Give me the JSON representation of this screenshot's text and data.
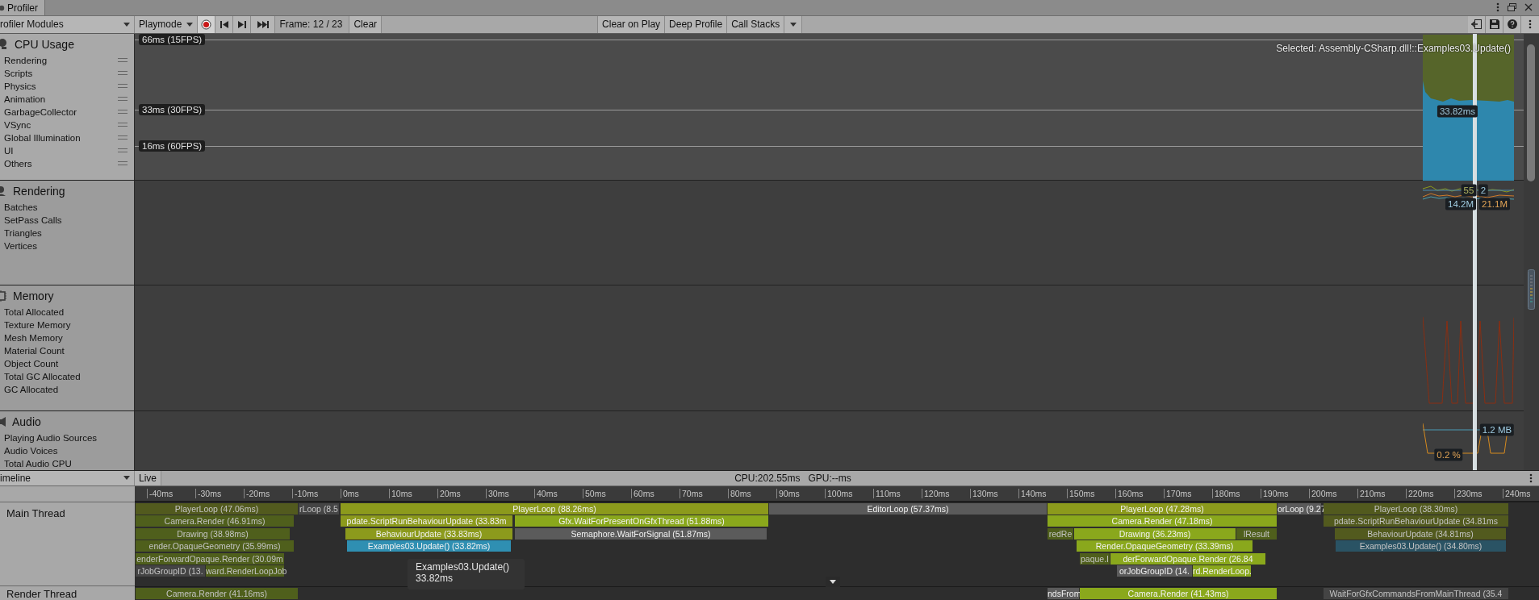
{
  "tab": {
    "title": "Profiler"
  },
  "toolbar": {
    "modules_dropdown": "rofiler Modules",
    "playmode": "Playmode",
    "recording": true,
    "frame": "Frame: 12 / 23",
    "clear": "Clear",
    "clear_on_play": {
      "label": "Clear on Play",
      "on": false
    },
    "deep_profile": {
      "label": "Deep Profile",
      "on": false
    },
    "call_stacks": "Call Stacks"
  },
  "modules": [
    {
      "title": "CPU Usage",
      "kind": "cpu",
      "selected": true,
      "items": [
        "Rendering",
        "Scripts",
        "Physics",
        "Animation",
        "GarbageCollector",
        "VSync",
        "Global Illumination",
        "UI",
        "Others"
      ],
      "thresholds": [
        "66ms (15FPS)",
        "33ms (30FPS)",
        "16ms (60FPS)"
      ],
      "selected_sample": "Selected: Assembly-CSharp.dll!::Examples03.Update()",
      "values": [
        {
          "text": "33.82ms",
          "kind": "time"
        }
      ]
    },
    {
      "title": "Rendering",
      "kind": "rendering",
      "selected": false,
      "items": [
        "Batches",
        "SetPass Calls",
        "Triangles",
        "Vertices"
      ],
      "values": [
        {
          "text": "55",
          "kind": "batches"
        },
        {
          "text": "2",
          "kind": "setpass"
        },
        {
          "text": "14.2M",
          "kind": "triangles"
        },
        {
          "text": "21.1M",
          "kind": "vertices"
        }
      ]
    },
    {
      "title": "Memory",
      "kind": "memory",
      "selected": false,
      "items": [
        "Total Allocated",
        "Texture Memory",
        "Mesh Memory",
        "Material Count",
        "Object Count",
        "Total GC Allocated",
        "GC Allocated"
      ]
    },
    {
      "title": "Audio",
      "kind": "audio",
      "selected": false,
      "items": [
        "Playing Audio Sources",
        "Audio Voices",
        "Total Audio CPU"
      ],
      "values": [
        {
          "text": "1.2 MB",
          "kind": "memory"
        },
        {
          "text": "0.2 %",
          "kind": "cpu"
        }
      ]
    }
  ],
  "timeline": {
    "view_dropdown": "imeline",
    "live": "Live",
    "cpu": "CPU:202.55ms",
    "gpu": "GPU:--ms",
    "ruler": [
      "-40ms",
      "-30ms",
      "-20ms",
      "-10ms",
      "0ms",
      "10ms",
      "20ms",
      "30ms",
      "40ms",
      "50ms",
      "60ms",
      "70ms",
      "80ms",
      "90ms",
      "100ms",
      "110ms",
      "120ms",
      "130ms",
      "140ms",
      "150ms",
      "160ms",
      "170ms",
      "180ms",
      "190ms",
      "200ms",
      "210ms",
      "220ms",
      "230ms",
      "240ms"
    ],
    "threads": [
      {
        "name": "Main Thread",
        "rows": [
          {
            "samples": [
              {
                "label": "PlayerLoop (47.06ms)",
                "kind": "loop",
                "dimmed": true
              },
              {
                "label": "rLoop (8.5",
                "kind": "editor",
                "dimmed": true
              },
              {
                "label": "PlayerLoop (88.26ms)",
                "kind": "loop",
                "dimmed": false
              },
              {
                "label": "EditorLoop (57.37ms)",
                "kind": "editor",
                "dimmed": false
              },
              {
                "label": "PlayerLoop (47.28ms)",
                "kind": "loop",
                "dimmed": false
              },
              {
                "label": "orLoop (9.27",
                "kind": "editor",
                "dimmed": false
              },
              {
                "label": "PlayerLoop (38.30ms)",
                "kind": "loop",
                "dimmed": true
              }
            ]
          },
          {
            "samples": [
              {
                "label": "Camera.Render (46.91ms)",
                "kind": "render",
                "dimmed": true
              },
              {
                "label": "pdate.ScriptRunBehaviourUpdate (33.83m",
                "kind": "loop",
                "dimmed": false
              },
              {
                "label": "Gfx.WaitForPresentOnGfxThread (51.88ms)",
                "kind": "render",
                "dimmed": false
              },
              {
                "label": "Camera.Render (47.18ms)",
                "kind": "render",
                "dimmed": false
              },
              {
                "label": "pdate.ScriptRunBehaviourUpdate (34.81ms",
                "kind": "loop",
                "dimmed": true
              }
            ]
          },
          {
            "samples": [
              {
                "label": "Drawing (38.98ms)",
                "kind": "render",
                "dimmed": true
              },
              {
                "label": "BehaviourUpdate (33.83ms)",
                "kind": "loop",
                "dimmed": false
              },
              {
                "label": "Semaphore.WaitForSignal (51.87ms)",
                "kind": "wait",
                "dimmed": false
              },
              {
                "label": "redRe",
                "kind": "render",
                "dimmed": true
              },
              {
                "label": "Drawing (36.23ms)",
                "kind": "render",
                "dimmed": false
              },
              {
                "label": "lResult",
                "kind": "render",
                "dimmed": true
              },
              {
                "label": "BehaviourUpdate (34.81ms)",
                "kind": "loop",
                "dimmed": true
              }
            ]
          },
          {
            "samples": [
              {
                "label": "ender.OpaqueGeometry (35.99ms)",
                "kind": "render",
                "dimmed": true
              },
              {
                "label": "Examples03.Update() (33.82ms)",
                "kind": "script",
                "dimmed": false
              },
              {
                "label": "Render.OpaqueGeometry (33.39ms)",
                "kind": "render",
                "dimmed": false
              },
              {
                "label": "Examples03.Update() (34.80ms)",
                "kind": "script",
                "dimmed": true
              }
            ]
          },
          {
            "samples": [
              {
                "label": "enderForwardOpaque.Render (30.09m",
                "kind": "render",
                "dimmed": true
              },
              {
                "label": "paque.I",
                "kind": "render",
                "dimmed": true
              },
              {
                "label": "derForwardOpaque.Render (26.84",
                "kind": "render",
                "dimmed": false
              }
            ]
          },
          {
            "samples": [
              {
                "label": "rJobGroupID (13.",
                "kind": "wait",
                "dimmed": true
              },
              {
                "label": "ward.RenderLoopJob",
                "kind": "render",
                "dimmed": true
              },
              {
                "label": "orJobGroupID (14.",
                "kind": "wait",
                "dimmed": false
              },
              {
                "label": "rd.RenderLoop.",
                "kind": "render",
                "dimmed": false
              }
            ]
          }
        ]
      },
      {
        "name": "Render Thread",
        "rows": [
          {
            "samples": [
              {
                "label": "Camera.Render (41.16ms)",
                "kind": "render",
                "dimmed": true
              },
              {
                "label": "ndsFrom",
                "kind": "wait",
                "dimmed": false
              },
              {
                "label": "Camera.Render (41.43ms)",
                "kind": "render",
                "dimmed": false
              },
              {
                "label": "WaitForGfxCommandsFromMainThread (35.4",
                "kind": "wait",
                "dimmed": true
              }
            ]
          }
        ]
      }
    ],
    "tooltip": {
      "title": "Examples03.Update()",
      "time": "33.82ms"
    }
  }
}
